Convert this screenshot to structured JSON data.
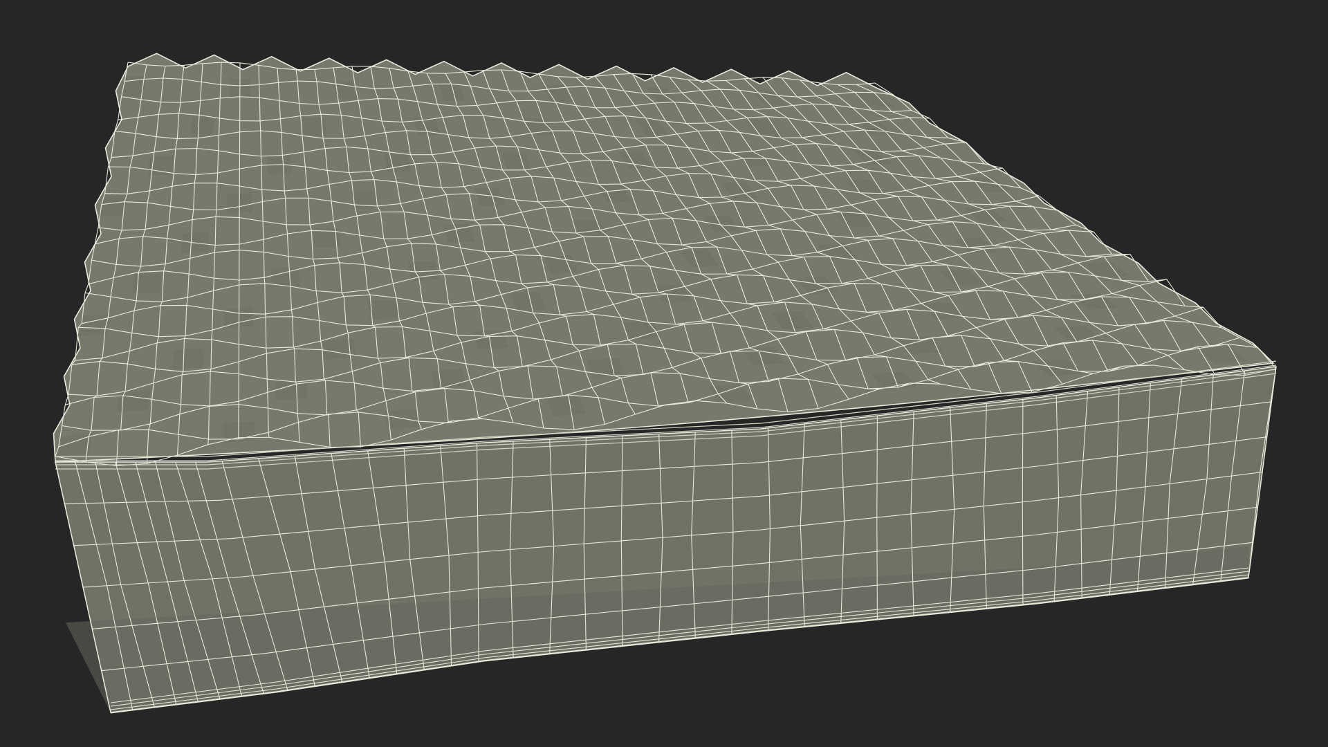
{
  "scene": {
    "subject": "mattress-wireframe-render",
    "colors": {
      "background": "#262626",
      "surface_top": "#78786d",
      "surface_top_shade": "#6f6f65",
      "surface_side": "#717166",
      "surface_side_shade": "#66665c",
      "wire": "#e9e9dc",
      "wire_soft": "#d4d4c6"
    }
  }
}
